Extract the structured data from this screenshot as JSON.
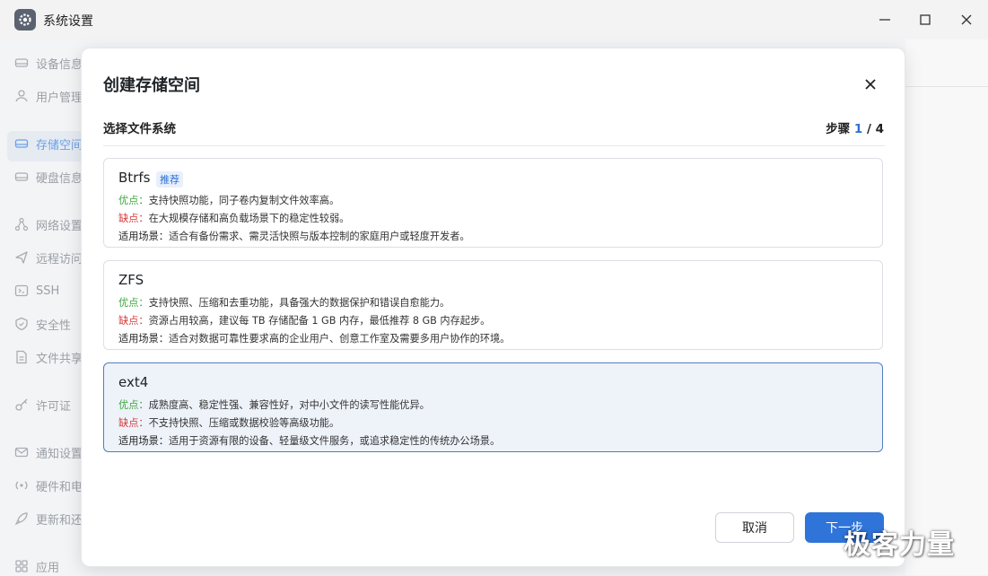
{
  "window": {
    "title": "系统设置"
  },
  "sidebar": {
    "items": [
      {
        "label": "设备信息",
        "icon": "drive-icon"
      },
      {
        "label": "用户管理",
        "icon": "user-icon"
      },
      {
        "label": "存储空间",
        "icon": "storage-icon",
        "active": true
      },
      {
        "label": "硬盘信息",
        "icon": "disk-icon"
      },
      {
        "label": "网络设置",
        "icon": "network-icon"
      },
      {
        "label": "远程访问",
        "icon": "send-icon"
      },
      {
        "label": "SSH",
        "icon": "terminal-icon"
      },
      {
        "label": "安全性",
        "icon": "shield-icon"
      },
      {
        "label": "文件共享",
        "icon": "file-icon"
      },
      {
        "label": "许可证",
        "icon": "key-icon"
      },
      {
        "label": "通知设置",
        "icon": "mail-icon"
      },
      {
        "label": "硬件和电源",
        "icon": "hardware-icon"
      },
      {
        "label": "更新和还原",
        "icon": "rocket-icon"
      },
      {
        "label": "应用",
        "icon": "app-icon"
      }
    ]
  },
  "modal": {
    "title": "创建存储空间",
    "section_title": "选择文件系统",
    "step_label": "步骤",
    "step_current": "1",
    "step_sep": "/",
    "step_total": "4",
    "options": [
      {
        "name": "Btrfs",
        "tag": "推荐",
        "pro_label": "优点：",
        "pro": "支持快照功能，同子卷内复制文件效率高。",
        "con_label": "缺点：",
        "con": "在大规模存储和高负载场景下的稳定性较弱。",
        "scene_label": "适用场景：",
        "scene": "适合有备份需求、需灵活快照与版本控制的家庭用户或轻度开发者。"
      },
      {
        "name": "ZFS",
        "pro_label": "优点：",
        "pro": "支持快照、压缩和去重功能，具备强大的数据保护和错误自愈能力。",
        "con_label": "缺点：",
        "con": "资源占用较高，建议每 TB 存储配备 1 GB 内存，最低推荐 8 GB 内存起步。",
        "scene_label": "适用场景：",
        "scene": "适合对数据可靠性要求高的企业用户、创意工作室及需要多用户协作的环境。"
      },
      {
        "name": "ext4",
        "selected": true,
        "pro_label": "优点：",
        "pro": "成熟度高、稳定性强、兼容性好，对中小文件的读写性能优异。",
        "con_label": "缺点：",
        "con": "不支持快照、压缩或数据校验等高级功能。",
        "scene_label": "适用场景：",
        "scene": "适用于资源有限的设备、轻量级文件服务，或追求稳定性的传统办公场景。"
      }
    ],
    "cancel_label": "取消",
    "next_label": "下一步"
  },
  "watermark": "极客力量",
  "colors": {
    "accent": "#2f74d9",
    "pro": "#3aa63a",
    "con": "#d83a3a",
    "selected_bg": "#eef3fa"
  }
}
